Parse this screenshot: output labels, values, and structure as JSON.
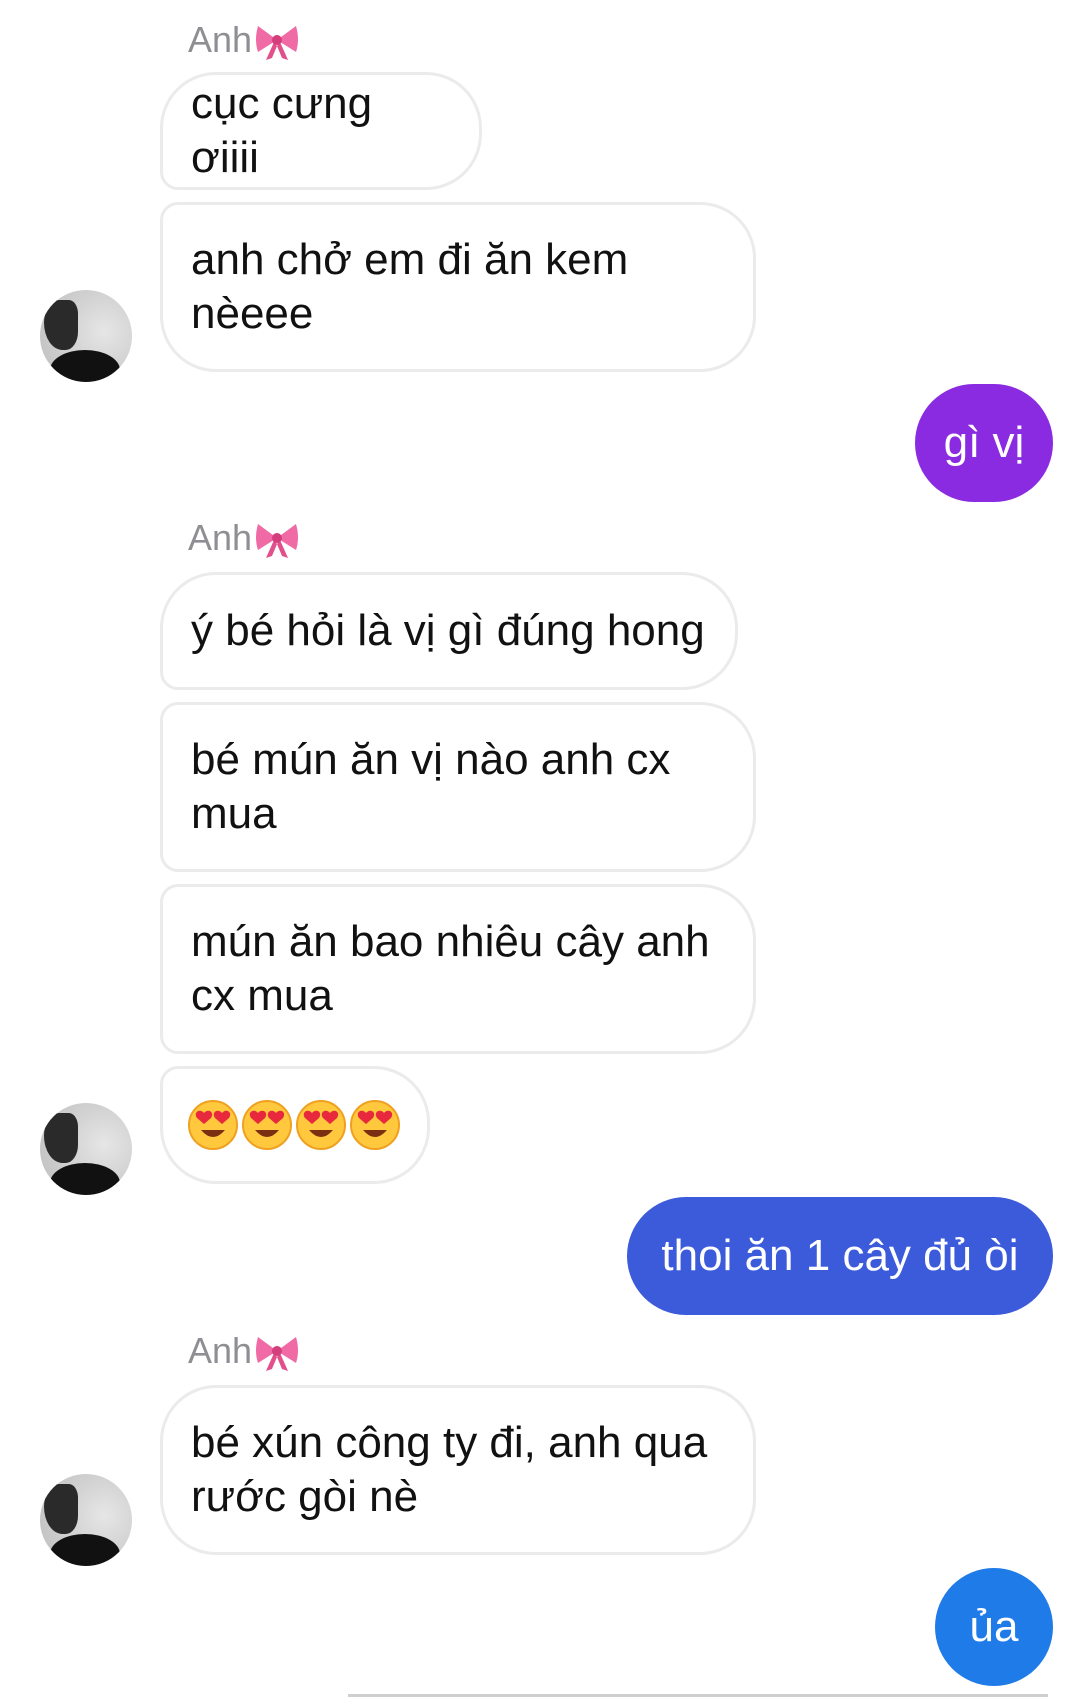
{
  "chat": {
    "sender_name": "Anh",
    "groups": [
      {
        "messages": [
          "cục cưng ơiiii",
          "anh chở em đi ăn kem nèeee"
        ]
      },
      {
        "messages": [
          "ý bé hỏi là vị gì đúng hong",
          "bé mún ăn vị nào anh cx mua",
          "mún ăn bao nhiêu cây anh cx mua"
        ],
        "emoji_count": 4,
        "emoji_icon": "heart-eyes-emoji"
      },
      {
        "messages": [
          "bé xún công ty đi, anh qua rước gòi nè"
        ]
      }
    ],
    "outgoing": [
      {
        "text": "gì vị",
        "color": "#8a2be2"
      },
      {
        "text": "thoi ăn 1 cây đủ òi",
        "color": "#3b5bdb"
      },
      {
        "text": "ủa",
        "color": "#1f7be8"
      }
    ],
    "bow_icon": "pink-bow-icon",
    "avatar_icon": "profile-photo-avatar"
  }
}
